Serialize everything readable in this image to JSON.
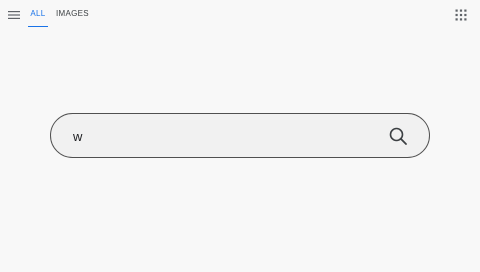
{
  "colors": {
    "background": "#f8f8f8",
    "search_box_fill": "#f1f1f1",
    "search_box_border": "#505050",
    "active_tab": "#1a73e8",
    "inactive_tab": "#3c4043",
    "icon": "#5f6368"
  },
  "header": {
    "menu_icon": "hamburger-menu-icon",
    "tabs": [
      {
        "label": "ALL",
        "active": true
      },
      {
        "label": "IMAGES",
        "active": false
      }
    ],
    "apps_icon": "apps-grid-icon"
  },
  "search": {
    "value": "w",
    "submit_icon": "search-icon"
  }
}
